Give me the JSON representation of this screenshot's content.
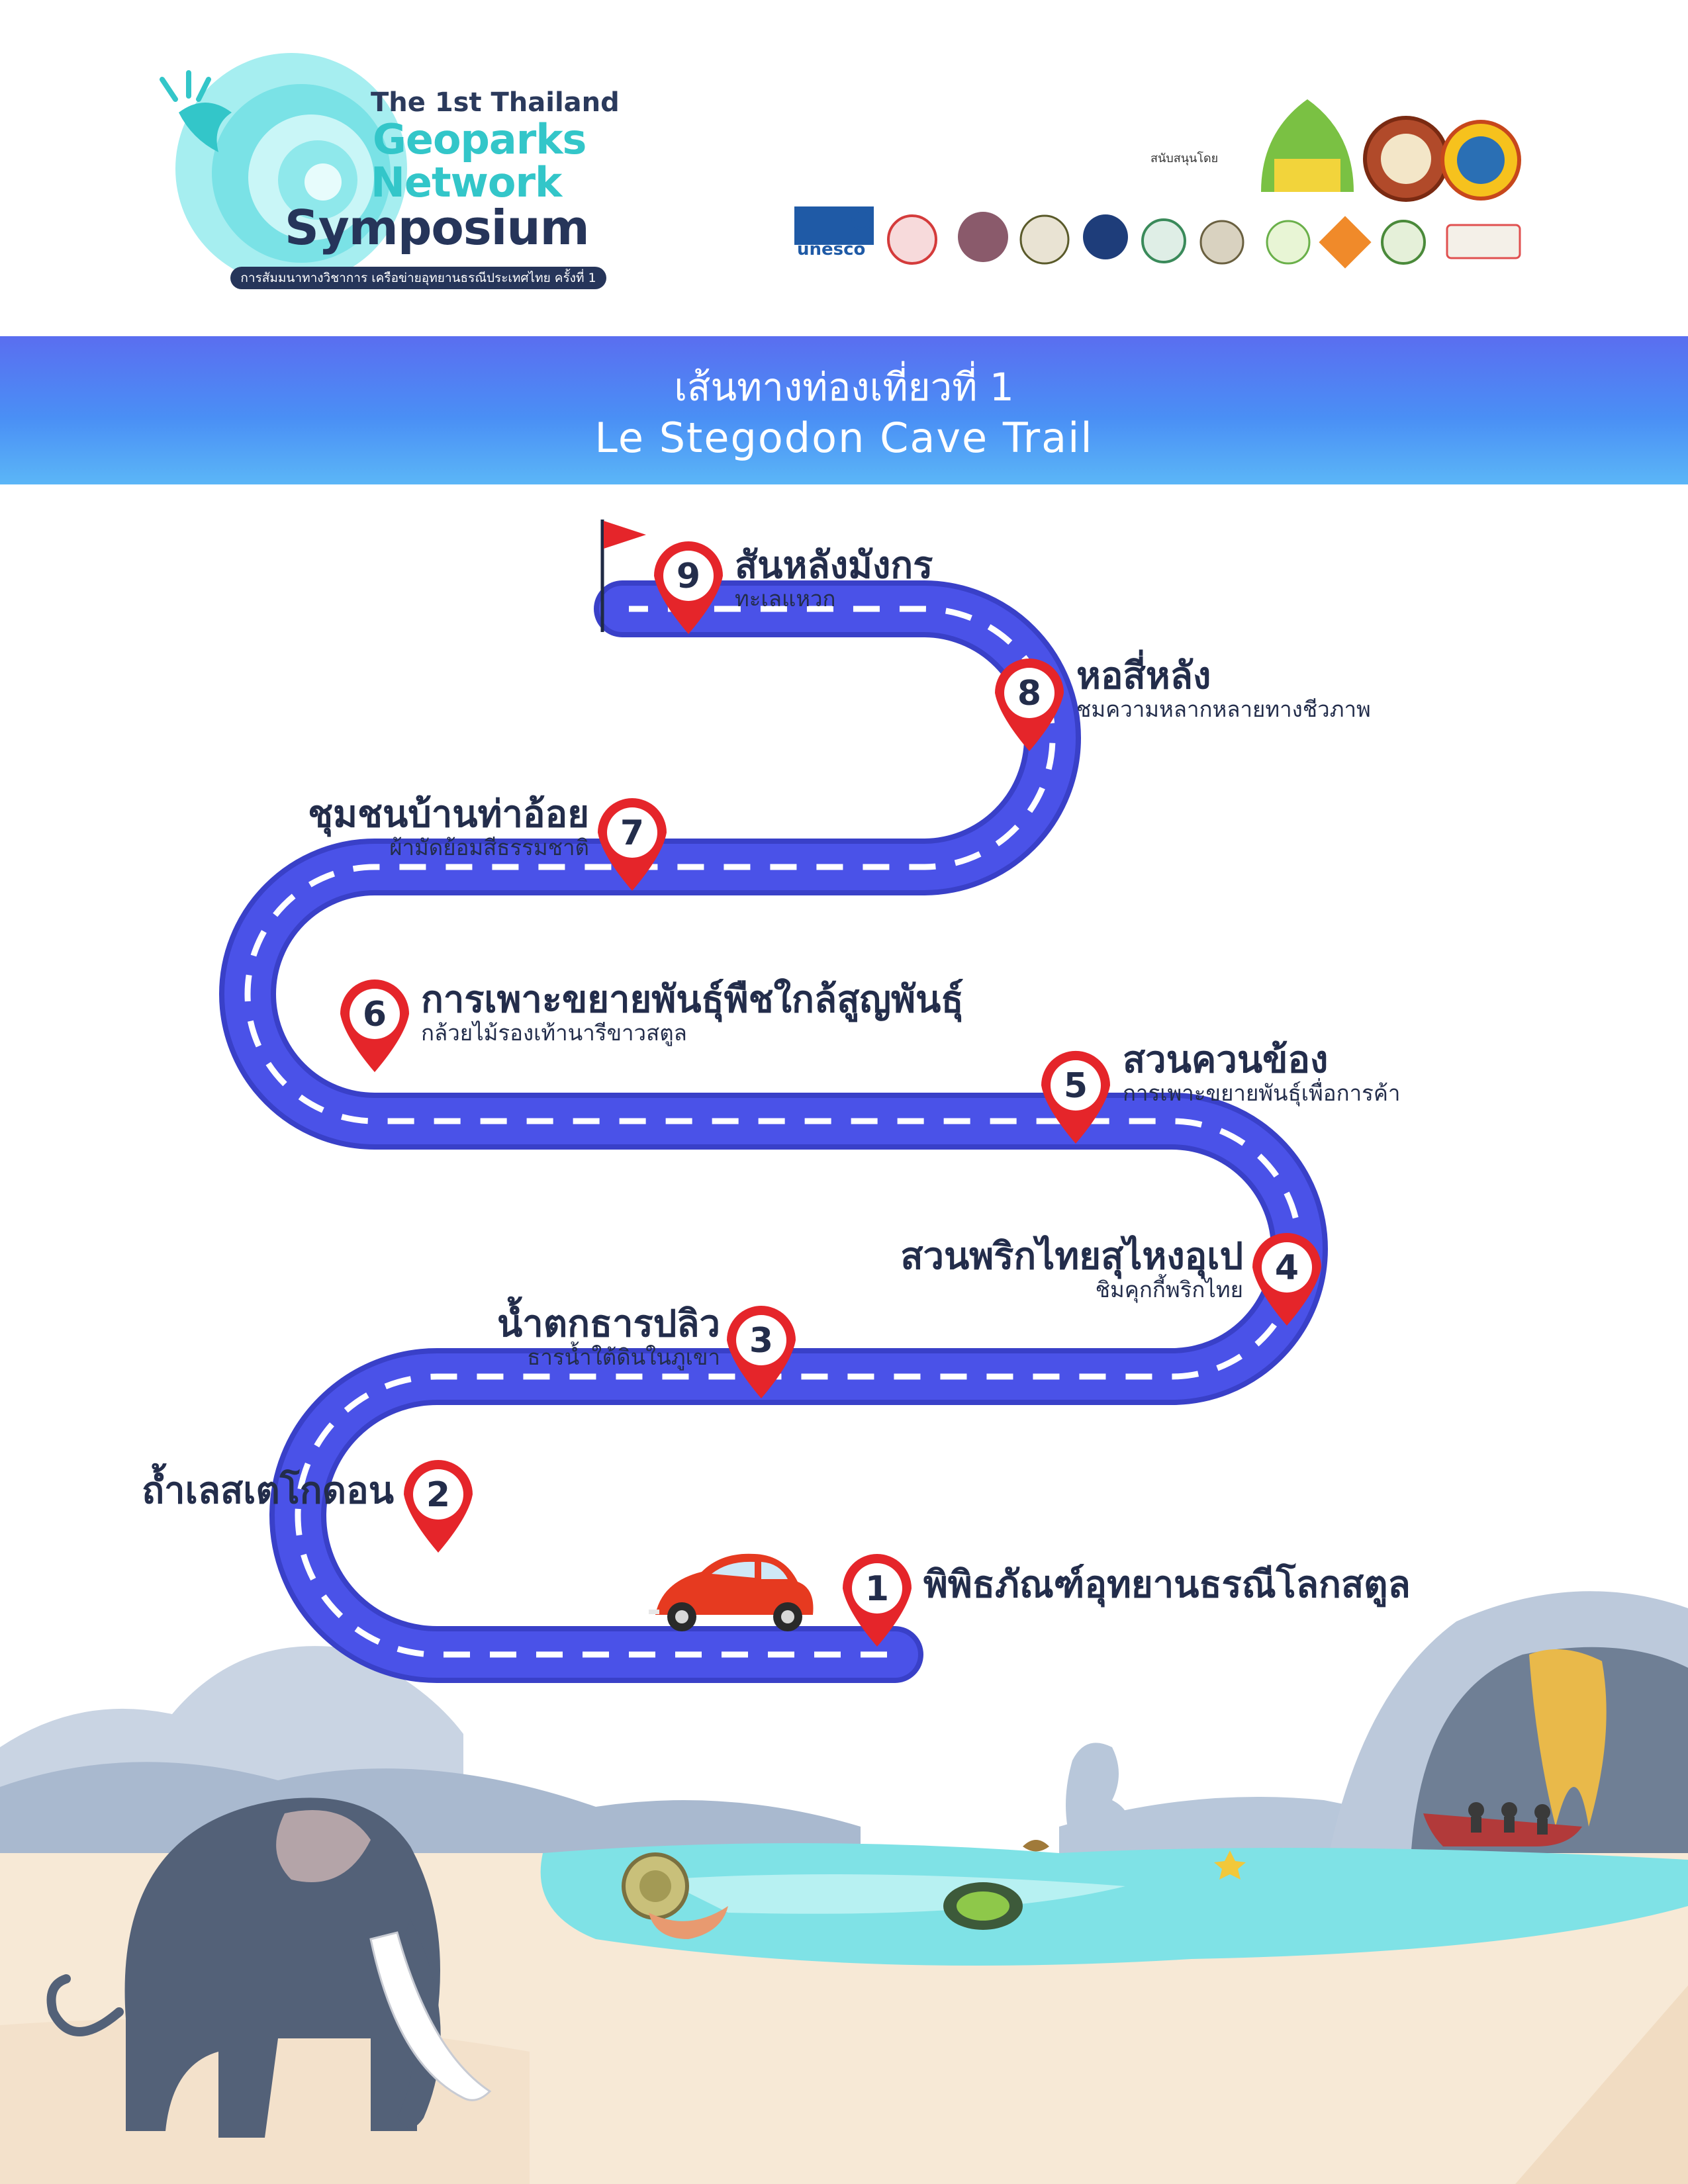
{
  "logo": {
    "line1": "The 1st Thailand",
    "line2": "Geoparks",
    "line3": "Network",
    "line4": "Symposium",
    "subtitle": "การสัมมนาทางวิชาการ เครือข่ายอุทยานธรณีประเทศไทย ครั้งที่ 1"
  },
  "sponsors": {
    "label": "สนับสนุนโดย",
    "unesco": "unesco"
  },
  "banner": {
    "title_th": "เส้นทางท่องเที่ยวที่ 1",
    "title_en": "Le Stegodon Cave Trail"
  },
  "stops": [
    {
      "number": "1",
      "name": "พิพิธภัณฑ์อุทยานธรณีโลกสตูล",
      "sub": ""
    },
    {
      "number": "2",
      "name": "ถ้ำเลสเตโกดอน",
      "sub": ""
    },
    {
      "number": "3",
      "name": "น้ำตกธารปลิว",
      "sub": "ธารน้ำใต้ดินในภูเขา"
    },
    {
      "number": "4",
      "name": "สวนพริกไทยสุไหงอุเป",
      "sub": "ชิมคุกกี้พริกไทย"
    },
    {
      "number": "5",
      "name": "สวนควนข้อง",
      "sub": "การเพาะขยายพันธุ์เพื่อการค้า"
    },
    {
      "number": "6",
      "name": "การเพาะขยายพันธุ์พืชใกล้สูญพันธุ์",
      "sub": "กล้วยไม้รองเท้านารีขาวสตูล"
    },
    {
      "number": "7",
      "name": "ชุมชนบ้านท่าอ้อย",
      "sub": "ผ้ามัดย้อมสีธรรมชาติ"
    },
    {
      "number": "8",
      "name": "หอสี่หลัง",
      "sub": "ชมความหลากหลายทางชีวภาพ"
    },
    {
      "number": "9",
      "name": "สันหลังมังกร",
      "sub": "ทะเลแหวก"
    }
  ],
  "colors": {
    "road": "#4a52e8",
    "road_edge": "#3940c8",
    "pin": "#e5252a",
    "banner": "#4a8ff5",
    "text": "#232d4b",
    "teal": "#33c6c9"
  }
}
